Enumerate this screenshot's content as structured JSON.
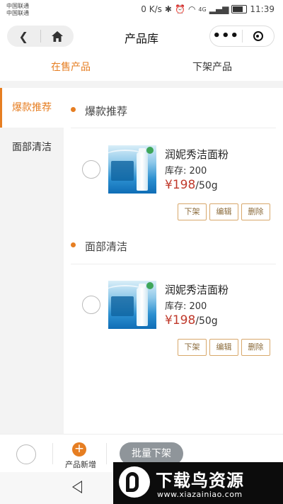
{
  "status_bar": {
    "carrier_line1": "中国联通",
    "carrier_line2": "中国联通",
    "speed": "0 K/s",
    "network": "4G",
    "time": "11:39"
  },
  "nav": {
    "title": "产品库",
    "more_icon": "more-dots-icon",
    "close_icon": "target-icon"
  },
  "tabs": [
    {
      "label": "在售产品",
      "active": true
    },
    {
      "label": "下架产品",
      "active": false
    }
  ],
  "sidebar": {
    "items": [
      {
        "label": "爆款推荐",
        "active": true
      },
      {
        "label": "面部清洁",
        "active": false
      }
    ]
  },
  "sections": [
    {
      "title": "爆款推荐",
      "products": [
        {
          "name": "润妮秀洁面粉",
          "stock": "库存: 200",
          "price": "¥198",
          "unit": "/50g",
          "buttons": [
            "下架",
            "编辑",
            "删除"
          ]
        }
      ]
    },
    {
      "title": "面部清洁",
      "products": [
        {
          "name": "润妮秀洁面粉",
          "stock": "库存: 200",
          "price": "¥198",
          "unit": "/50g",
          "buttons": [
            "下架",
            "编辑",
            "删除"
          ]
        }
      ]
    }
  ],
  "bottom": {
    "add_label": "产品新增",
    "batch_label": "批量下架"
  },
  "watermark": {
    "text": "下载鸟资源",
    "url": "www.xiazainiao.com"
  },
  "colors": {
    "accent": "#e67e22",
    "price": "#c0392b",
    "button_border": "#d8a86b",
    "batch_bg": "#8f959a"
  }
}
